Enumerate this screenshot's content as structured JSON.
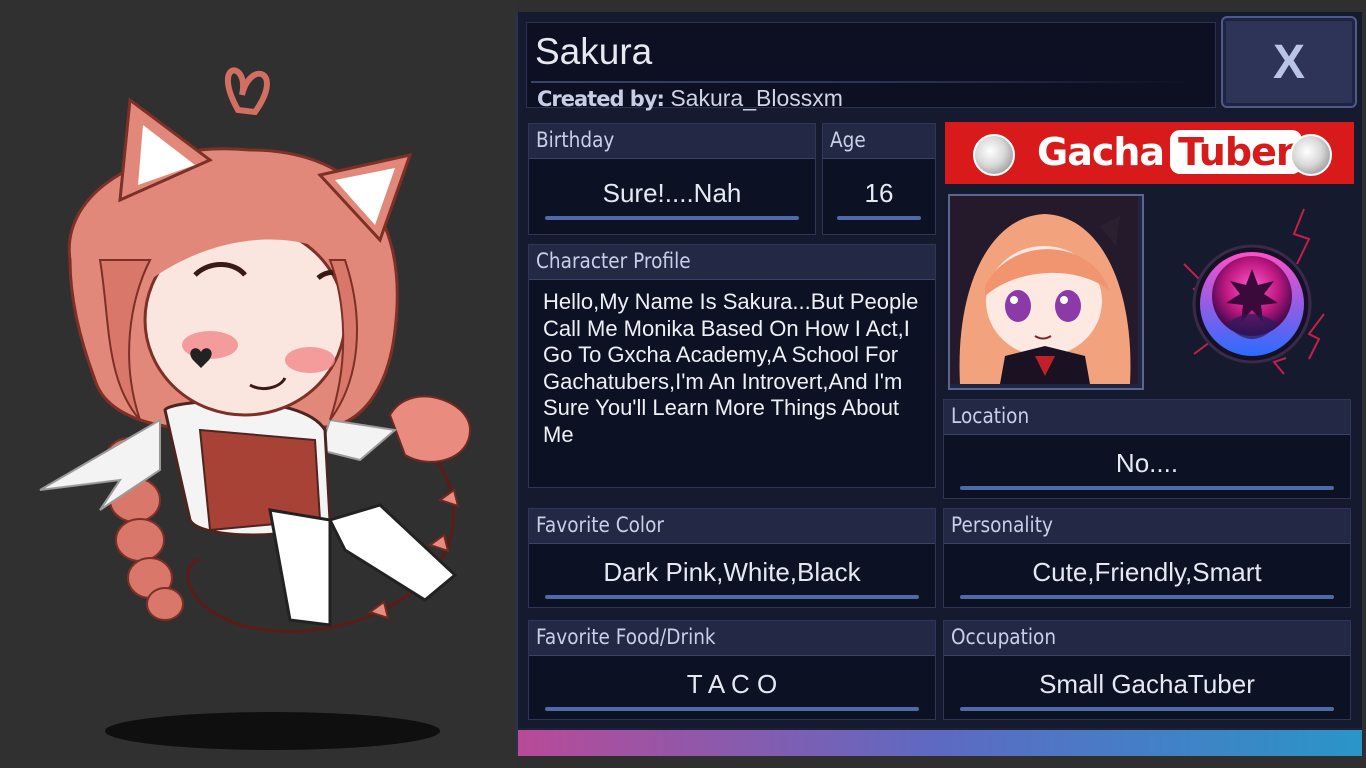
{
  "character": {
    "name": "Sakura",
    "created_by_label": "Created by:",
    "creator": "Sakura_Blossxm"
  },
  "close_button": {
    "label": "X"
  },
  "fields": {
    "birthday": {
      "label": "Birthday",
      "value": "Sure!....Nah"
    },
    "age": {
      "label": "Age",
      "value": "16"
    },
    "profile": {
      "label": "Character Profile",
      "text": "Hello,My Name Is Sakura...But People Call Me Monika Based On How I Act,I Go To Gxcha Academy,A School For Gachatubers,I'm An Introvert,And I'm Sure You'll Learn More Things About Me"
    },
    "location": {
      "label": "Location",
      "value": "No...."
    },
    "favorite_color": {
      "label": "Favorite Color",
      "value": "Dark Pink,White,Black"
    },
    "personality": {
      "label": "Personality",
      "value": "Cute,Friendly,Smart"
    },
    "favorite_food": {
      "label": "Favorite Food/Drink",
      "value": "T A C O"
    },
    "occupation": {
      "label": "Occupation",
      "value": "Small GachaTuber"
    }
  },
  "banner": {
    "part1": "Gacha",
    "part2": "Tuber"
  },
  "icons": {
    "portrait": "character-portrait-icon",
    "badge": "dark-magic-orb-icon",
    "close": "close-icon"
  },
  "colors": {
    "panel_bg": "#161a2e",
    "field_header": "#232944",
    "accent_line": "#4e6aa8",
    "banner_red": "#d91a1a"
  }
}
